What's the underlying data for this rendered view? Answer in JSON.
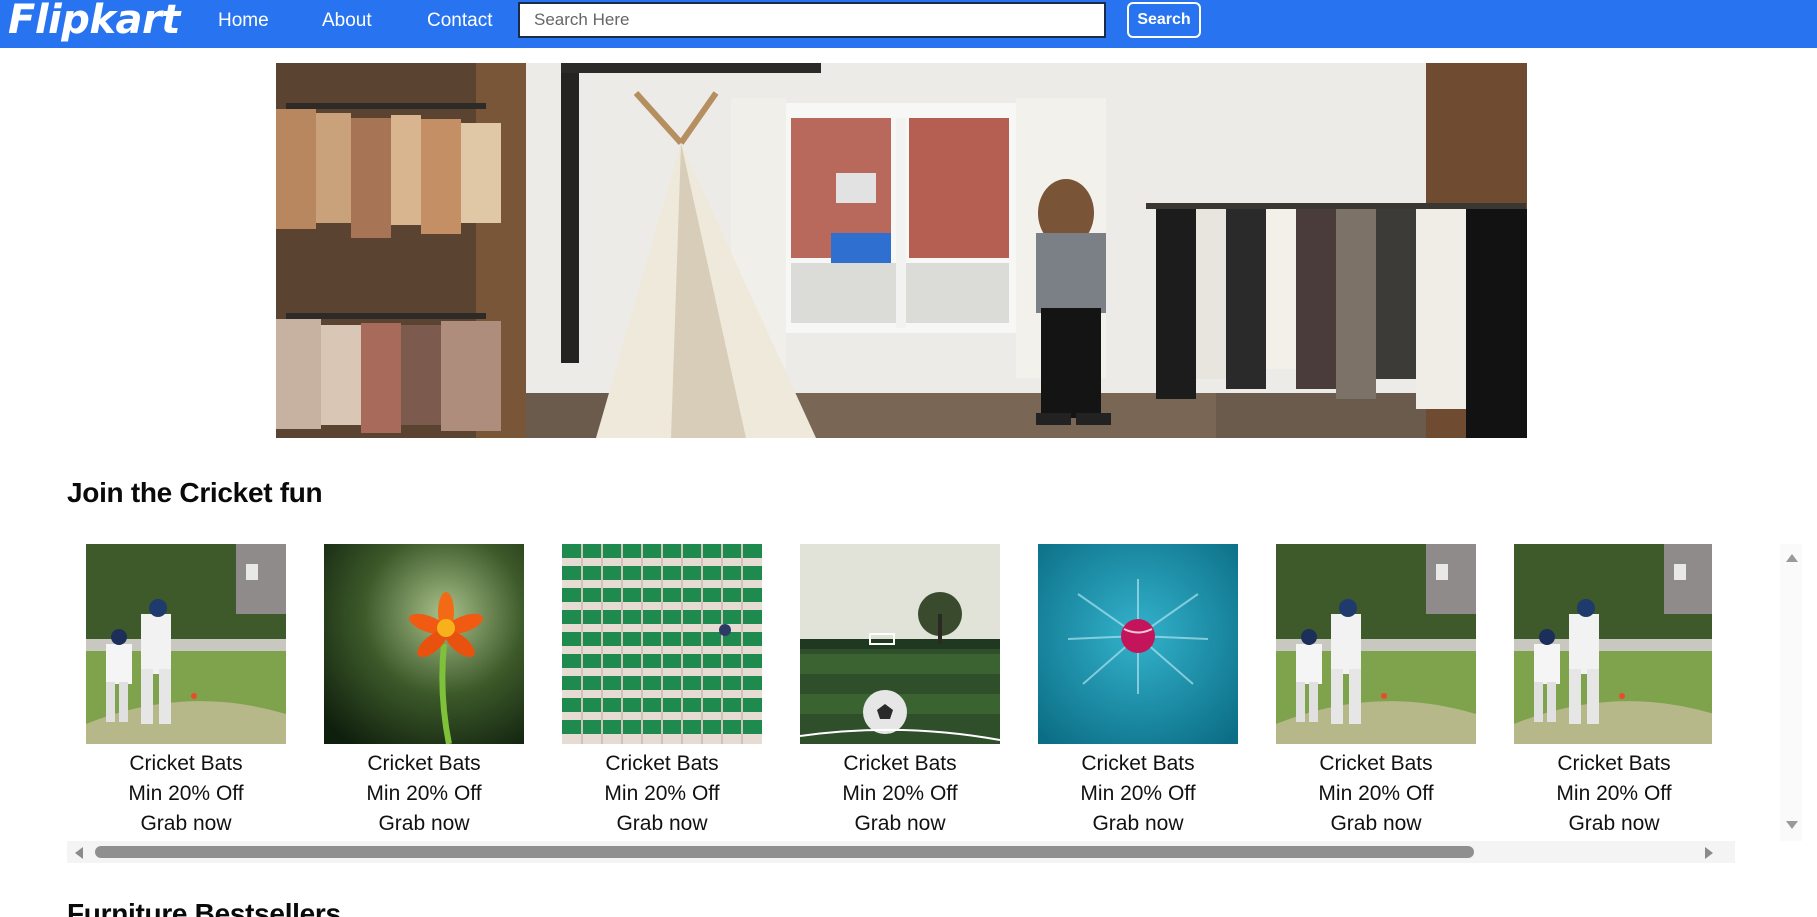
{
  "navbar": {
    "logo": "Flipkart",
    "links": [
      "Home",
      "About",
      "Contact"
    ],
    "search_placeholder": "Search Here",
    "search_value": "",
    "search_button": "Search"
  },
  "sections": [
    {
      "title": "Join the Cricket fun",
      "cards": [
        {
          "image": "cricket-batsman-image",
          "name": "Cricket Bats",
          "offer": "Min 20% Off",
          "cta": "Grab now"
        },
        {
          "image": "orange-flower-image",
          "name": "Cricket Bats",
          "offer": "Min 20% Off",
          "cta": "Grab now"
        },
        {
          "image": "stadium-seats-image",
          "name": "Cricket Bats",
          "offer": "Min 20% Off",
          "cta": "Grab now"
        },
        {
          "image": "football-field-image",
          "name": "Cricket Bats",
          "offer": "Min 20% Off",
          "cta": "Grab now"
        },
        {
          "image": "cricket-ball-image",
          "name": "Cricket Bats",
          "offer": "Min 20% Off",
          "cta": "Grab now"
        },
        {
          "image": "cricket-batsman-image",
          "name": "Cricket Bats",
          "offer": "Min 20% Off",
          "cta": "Grab now"
        },
        {
          "image": "cricket-batsman-image",
          "name": "Cricket Bats",
          "offer": "Min 20% Off",
          "cta": "Grab now"
        }
      ]
    },
    {
      "title": "Furniture Bestsellers"
    }
  ],
  "colors": {
    "navbar": "#2874f0",
    "text": "#111111",
    "scrollbar_thumb": "#8f8f8f"
  }
}
